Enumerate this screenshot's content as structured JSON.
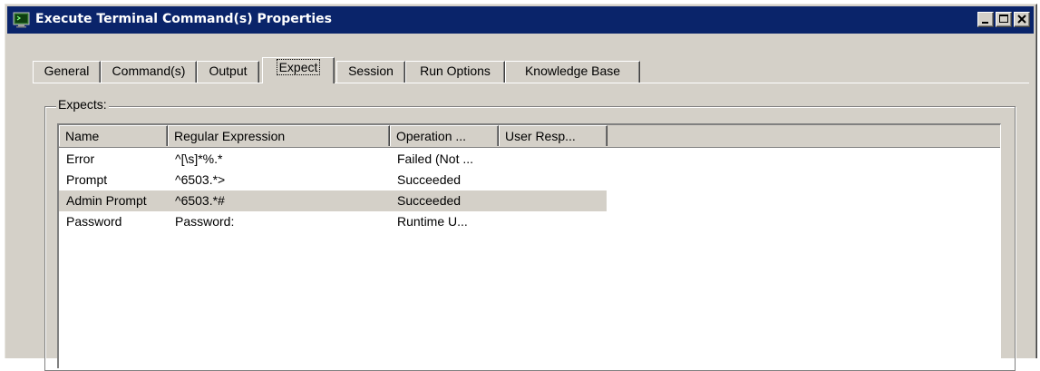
{
  "window": {
    "title": "Execute Terminal Command(s) Properties",
    "icon": "terminal-icon",
    "controls": [
      "minimize-icon",
      "maximize-icon",
      "close-icon"
    ]
  },
  "tabs": [
    {
      "label": "General",
      "active": false
    },
    {
      "label": "Command(s)",
      "active": false
    },
    {
      "label": "Output",
      "active": false
    },
    {
      "label": "Expect",
      "active": true
    },
    {
      "label": "Session",
      "active": false
    },
    {
      "label": "Run Options",
      "active": false
    },
    {
      "label": "Knowledge Base",
      "active": false
    }
  ],
  "expects": {
    "group_label": "Expects:",
    "columns": [
      "Name",
      "Regular Expression",
      "Operation ...",
      "User Resp..."
    ],
    "rows": [
      {
        "name": "Error",
        "regex": "^[\\s]*%.*",
        "operation": "Failed (Not ...",
        "user_response": ""
      },
      {
        "name": "Prompt",
        "regex": "^6503.*>",
        "operation": "Succeeded",
        "user_response": ""
      },
      {
        "name": "Admin Prompt",
        "regex": "^6503.*#",
        "operation": "Succeeded",
        "user_response": "",
        "selected": true
      },
      {
        "name": "Password",
        "regex": "Password:",
        "operation": "Runtime U...",
        "user_response": ""
      }
    ]
  },
  "colors": {
    "titlebar": "#0a246a",
    "dialog_bg": "#d4d0c8",
    "list_bg": "#ffffff",
    "selected_row": "#d4d0c8"
  }
}
